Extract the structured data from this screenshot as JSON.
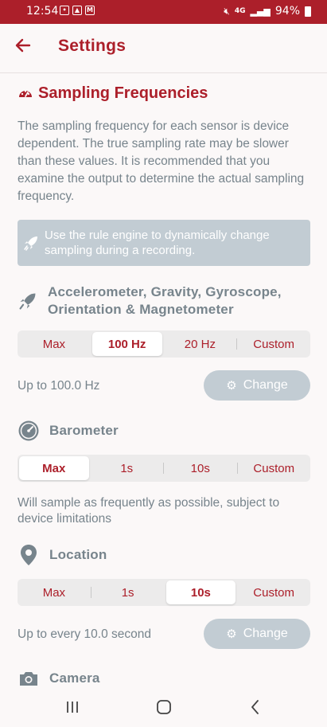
{
  "status_bar": {
    "time": "12:54",
    "network": "4G",
    "battery": "94%"
  },
  "header": {
    "title": "Settings"
  },
  "section": {
    "title": "Sampling Frequencies",
    "intro": "The sampling frequency for each sensor is device dependent. The true sampling rate may be slower than these values. It is recommended that you examine the output to determine the actual sampling frequency."
  },
  "banner": {
    "text": "Use the rule engine to dynamically change sampling during a recording."
  },
  "sensors": {
    "motion": {
      "title": "Accelerometer, Gravity, Gyroscope, Orientation & Magnetometer",
      "options": [
        "Max",
        "100 Hz",
        "20 Hz",
        "Custom"
      ],
      "selected": "100 Hz",
      "info": "Up to 100.0 Hz",
      "change_label": "Change"
    },
    "barometer": {
      "title": "Barometer",
      "options": [
        "Max",
        "1s",
        "10s",
        "Custom"
      ],
      "selected": "Max",
      "info": "Will sample as frequently as possible, subject to device limitations"
    },
    "location": {
      "title": "Location",
      "options": [
        "Max",
        "1s",
        "10s",
        "Custom"
      ],
      "selected": "10s",
      "info": "Up to every 10.0 second",
      "change_label": "Change"
    },
    "camera": {
      "title": "Camera"
    }
  },
  "colors": {
    "accent": "#ac1f2a",
    "muted_text": "#77848c",
    "button_disabled": "#c2ccd3",
    "segment_bg": "#ecebeb",
    "background": "#fbf8f8"
  }
}
